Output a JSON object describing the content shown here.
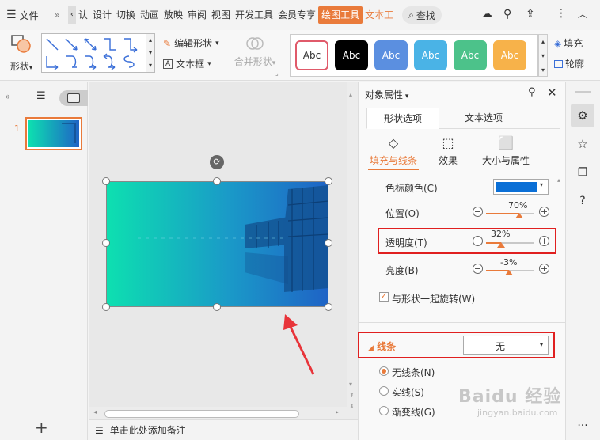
{
  "menubar": {
    "file_label": "文件",
    "items": [
      "认",
      "设计",
      "切换",
      "动画",
      "放映",
      "审阅",
      "视图",
      "开发工具",
      "会员专享",
      "绘图工具",
      "文本工"
    ],
    "active_item": "绘图工具",
    "search_label": "查找"
  },
  "ribbon": {
    "shape_label": "形状",
    "edit_shape_label": "编辑形状",
    "textbox_label": "文本框",
    "merge_shape_label": "合并形状",
    "fill_label": "填充",
    "outline_label": "轮廓",
    "style_swatches": [
      {
        "label": "Abc",
        "bg": "#ffffff",
        "fg": "#333333",
        "border": "#e05a6a"
      },
      {
        "label": "Abc",
        "bg": "#000000",
        "fg": "#ffffff",
        "border": "#000000"
      },
      {
        "label": "Abc",
        "bg": "#5b8fe0",
        "fg": "#ffffff",
        "border": "#5b8fe0"
      },
      {
        "label": "Abc",
        "bg": "#4ab3e6",
        "fg": "#ffffff",
        "border": "#4ab3e6"
      },
      {
        "label": "Abc",
        "bg": "#4cc28a",
        "fg": "#ffffff",
        "border": "#4cc28a"
      },
      {
        "label": "Abc",
        "bg": "#f7b24a",
        "fg": "#ffffff",
        "border": "#f7b24a"
      }
    ]
  },
  "slides": {
    "current_number": "1"
  },
  "status": {
    "notes_placeholder": "单击此处添加备注"
  },
  "props": {
    "title": "对象属性",
    "tabs": [
      "形状选项",
      "文本选项"
    ],
    "subtabs": [
      "填充与线条",
      "效果",
      "大小与属性"
    ],
    "stop_color_label": "色标颜色(C)",
    "stop_color_value": "#0a6fd6",
    "position_label": "位置(O)",
    "position_value": "70%",
    "position_fraction": 0.7,
    "transparency_label": "透明度(T)",
    "transparency_value": "32%",
    "transparency_fraction": 0.32,
    "brightness_label": "亮度(B)",
    "brightness_value": "-3%",
    "brightness_fraction": 0.485,
    "rotate_with_shape_label": "与形状一起旋转(W)",
    "line_section_label": "线条",
    "line_select_value": "无",
    "line_options": [
      "无线条(N)",
      "实线(S)",
      "渐变线(G)"
    ],
    "selected_line_option": 0
  },
  "colors": {
    "accent": "#e97a3a",
    "highlight_box": "#e02020",
    "arrow": "#e8343a",
    "slide_gradient_start": "#0de0b0",
    "slide_gradient_end": "#1f63c6"
  },
  "watermark": {
    "text": "Baidu 经验",
    "url": "jingyan.baidu.com"
  }
}
